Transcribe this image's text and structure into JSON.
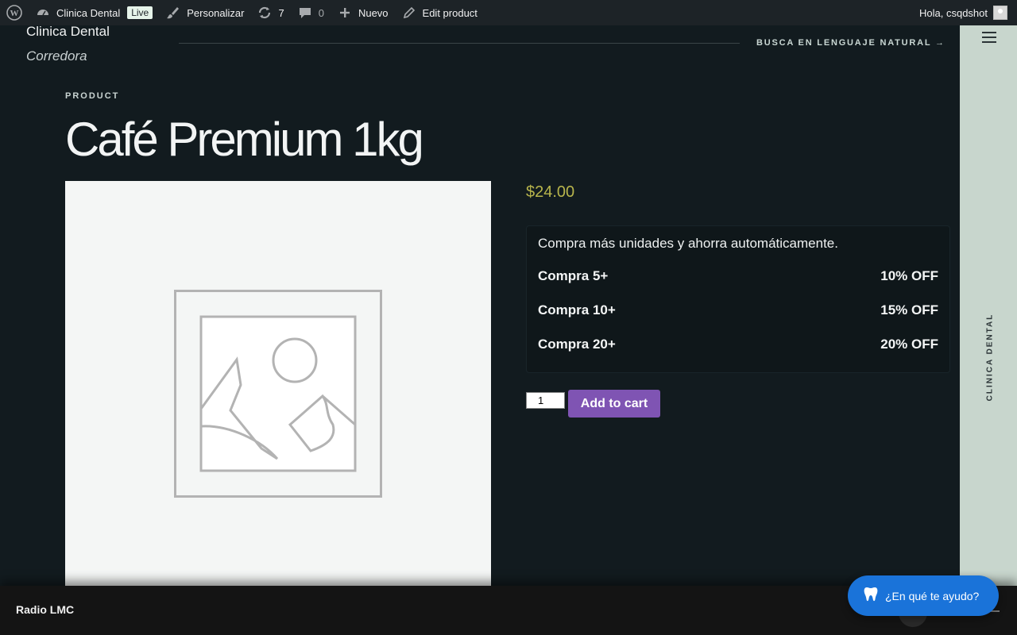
{
  "adminbar": {
    "wp_logo": "wordpress-icon",
    "site_name": "Clinica Dental",
    "live_badge": "Live",
    "customize": "Personalizar",
    "updates_count": "7",
    "comments_count": "0",
    "new": "Nuevo",
    "edit": "Edit product",
    "greeting": "Hola, csqdshot"
  },
  "header": {
    "brand_name": "Clinica Dental",
    "brand_sub": "Corredora",
    "cta": "BUSCA EN LENGUAJE NATURAL →"
  },
  "product": {
    "kicker": "PRODUCT",
    "title": "Café Premium 1kg",
    "price": "$24.00",
    "discount_intro": "Compra más unidades y ahorra automáticamente.",
    "tiers": [
      {
        "label": "Compra 5+",
        "value": "10% OFF"
      },
      {
        "label": "Compra 10+",
        "value": "15% OFF"
      },
      {
        "label": "Compra 20+",
        "value": "20% OFF"
      }
    ],
    "quantity": "1",
    "add_to_cart": "Add to cart"
  },
  "sidebar": {
    "label": "CLINICA DENTAL"
  },
  "player": {
    "title": "Radio LMC"
  },
  "chat": {
    "label": "¿En qué te ayudo?"
  },
  "colors": {
    "background": "#121b1f",
    "accent_purple": "#7f54b3",
    "price": "#b8b54c",
    "chat_blue": "#1a73d9",
    "sidebar": "#c8d6cd"
  }
}
